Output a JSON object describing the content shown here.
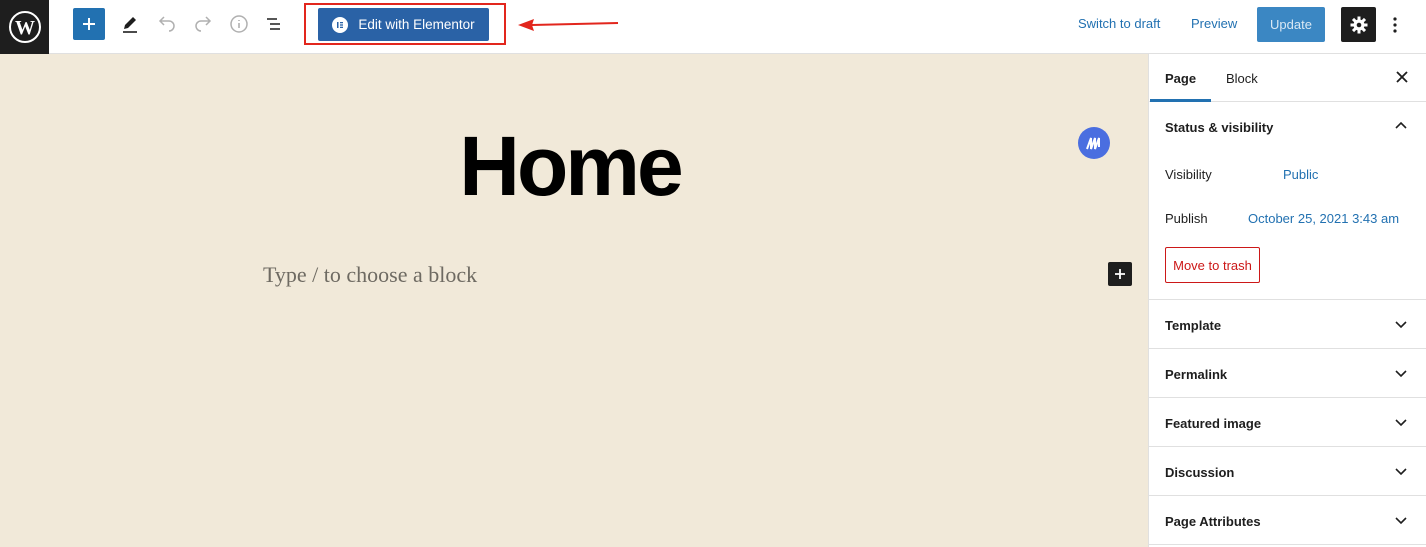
{
  "toolbar": {
    "edit_elementor_label": "Edit with Elementor",
    "switch_to_draft": "Switch to draft",
    "preview": "Preview",
    "update": "Update"
  },
  "editor": {
    "post_title": "Home",
    "block_placeholder": "Type / to choose a block"
  },
  "sidebar": {
    "tabs": [
      {
        "label": "Page",
        "active": true
      },
      {
        "label": "Block",
        "active": false
      }
    ],
    "status_visibility": {
      "title": "Status & visibility",
      "visibility_label": "Visibility",
      "visibility_value": "Public",
      "publish_label": "Publish",
      "publish_value": "October 25, 2021 3:43 am",
      "trash_label": "Move to trash"
    },
    "panels": [
      {
        "label": "Template"
      },
      {
        "label": "Permalink"
      },
      {
        "label": "Featured image"
      },
      {
        "label": "Discussion"
      },
      {
        "label": "Page Attributes"
      }
    ]
  },
  "colors": {
    "accent": "#2271b1",
    "canvas_bg": "#f1e9d9",
    "highlight": "#e2261d",
    "danger": "#cc1818"
  }
}
